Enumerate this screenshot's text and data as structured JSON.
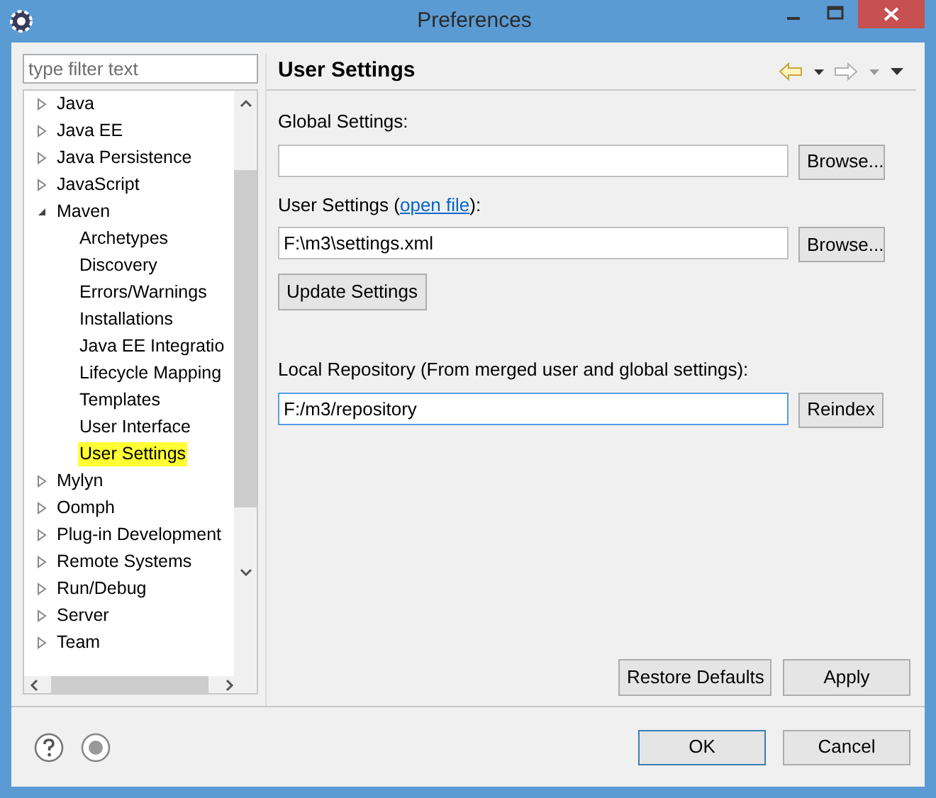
{
  "window": {
    "title": "Preferences"
  },
  "filter": {
    "placeholder": "type filter text"
  },
  "tree": [
    {
      "label": "Java",
      "expanded": false,
      "selected": false
    },
    {
      "label": "Java EE",
      "expanded": false,
      "selected": false
    },
    {
      "label": "Java Persistence",
      "expanded": false,
      "selected": false
    },
    {
      "label": "JavaScript",
      "expanded": false,
      "selected": false
    },
    {
      "label": "Maven",
      "expanded": true,
      "selected": false,
      "children": [
        {
          "label": "Archetypes",
          "selected": false
        },
        {
          "label": "Discovery",
          "selected": false
        },
        {
          "label": "Errors/Warnings",
          "selected": false
        },
        {
          "label": "Installations",
          "selected": false
        },
        {
          "label": "Java EE Integratio",
          "selected": false
        },
        {
          "label": "Lifecycle Mapping",
          "selected": false
        },
        {
          "label": "Templates",
          "selected": false
        },
        {
          "label": "User Interface",
          "selected": false
        },
        {
          "label": "User Settings",
          "selected": true
        }
      ]
    },
    {
      "label": "Mylyn",
      "expanded": false,
      "selected": false
    },
    {
      "label": "Oomph",
      "expanded": false,
      "selected": false
    },
    {
      "label": "Plug-in Development",
      "expanded": false,
      "selected": false
    },
    {
      "label": "Remote Systems",
      "expanded": false,
      "selected": false
    },
    {
      "label": "Run/Debug",
      "expanded": false,
      "selected": false
    },
    {
      "label": "Server",
      "expanded": false,
      "selected": false
    },
    {
      "label": "Team",
      "expanded": false,
      "selected": false
    }
  ],
  "page": {
    "title": "User Settings",
    "global_settings": {
      "label": "Global Settings:",
      "button": "Browse..."
    },
    "user_settings": {
      "label_before": "User Settings (",
      "link": "open file",
      "label_after": "):",
      "value": "F:\\m3\\settings.xml",
      "button": "Browse..."
    },
    "update_button": "Update Settings",
    "local_repository": {
      "label": "Local Repository (From merged user and global settings):",
      "value": "F:/m3/repository",
      "focused": true,
      "button": "Reindex"
    },
    "buttons": [
      {
        "label": "Restore Defaults"
      },
      {
        "label": "Apply"
      }
    ]
  },
  "dialog_buttons": [
    {
      "label": "OK",
      "default": true
    },
    {
      "label": "Cancel",
      "default": false
    }
  ]
}
